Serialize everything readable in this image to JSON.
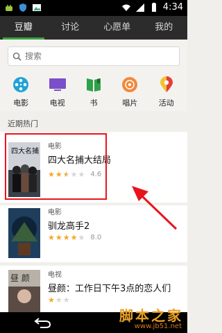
{
  "status_bar": {
    "time": "4:34"
  },
  "tabs": [
    {
      "label": "豆瓣",
      "active": true
    },
    {
      "label": "讨论",
      "active": false
    },
    {
      "label": "心愿单",
      "active": false
    },
    {
      "label": "我的",
      "active": false
    }
  ],
  "search": {
    "placeholder": "搜索"
  },
  "categories": [
    {
      "label": "电影",
      "icon": "film-reel-icon"
    },
    {
      "label": "电视",
      "icon": "tv-icon"
    },
    {
      "label": "书",
      "icon": "book-icon"
    },
    {
      "label": "唱片",
      "icon": "record-icon"
    },
    {
      "label": "活动",
      "icon": "location-pin-icon"
    }
  ],
  "section_title": "近期热门",
  "items": [
    {
      "type": "电影",
      "title": "四大名捕大结局",
      "stars": 2.5,
      "rating": "4.6"
    },
    {
      "type": "电影",
      "title": "驯龙高手2",
      "stars": 4,
      "rating": "8.0"
    },
    {
      "type": "电视",
      "title": "昼颜：工作日下午3点的恋人们",
      "stars": 1,
      "rating": ""
    }
  ],
  "posters": [
    {
      "text": "四大名捕"
    },
    {
      "text": ""
    },
    {
      "text": "昼 颜"
    }
  ],
  "highlight": {
    "color": "#e8141c"
  },
  "watermark": {
    "title": "脚本之家",
    "url": "www.jb51.net"
  },
  "colors": {
    "tab_bar": "#2c2c2c",
    "tab_indicator": "#3ca341",
    "star": "#f5a623",
    "annotation": "#e8141c"
  }
}
